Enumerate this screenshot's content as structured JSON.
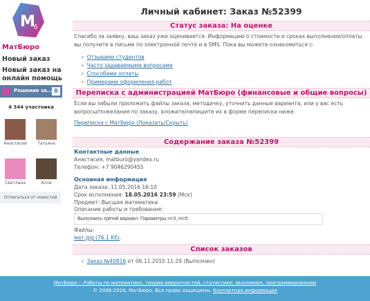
{
  "sidebar": {
    "logo_text": "Мб",
    "brand": "МатБюро",
    "nav": [
      "Новый заказ",
      "Новый заказ на онлайн помощь"
    ],
    "vk": {
      "title": "Решение за...",
      "badge": "B",
      "members": "4 344 участника",
      "people": [
        "Анастасия",
        "Татьяна",
        "Светлана",
        "Алла"
      ],
      "unsubscribe": "Отписаться от новостей"
    }
  },
  "main": {
    "title": "Личный кабинет: Заказ №52399",
    "status": {
      "heading": "Статус заказа: На оценке",
      "text": "Спасибо за заявку, ваш заказ уже оценивается. Информацию о стоимости и сроках выполнения/оплаты вы получите в письме по электронной почте и в SMS. Пока вы можете ознакомиться с:",
      "links": [
        "Отзывами студентов",
        "Часто задаваемыми вопросами",
        "Способами оплаты",
        "Примерами оформления работ"
      ]
    },
    "correspondence": {
      "heading": "Переписка с администрацией МатБюро (финансовые и общие вопросы)",
      "text": "Если вы забыли приложить файлы заказа, методичку, уточнить данные варианта, или у вас есть вопросы/пожелания по заказу, вложите/напишите их в форме переписки ниже.",
      "toggle": "Переписка с МатБюро (Показать/Скрыть)"
    },
    "contents": {
      "heading": "Содержание заказа №52399",
      "contact_heading": "Контактные данные",
      "contact": "Анастасия, matburo@yandex.ru",
      "phone": "Телефон: +7 9046290455",
      "info_heading": "Основная информация",
      "date": "Дата заказа: 11.05.2016 16:10",
      "deadline_label": "Срок исполнения:",
      "deadline": "18.05.2016 23:59",
      "deadline_tz": "(Мск)",
      "subject": "Предмет: Высшая математика",
      "desc_label": "Описание работы и требования:",
      "desc": "Выполнить третий вариант. Параметры n=3, m=5",
      "files_label": "Файлы:",
      "file": "мат.jpg (76.1 Кб)"
    },
    "orders": {
      "heading": "Список заказов",
      "link": "Заказ №40816",
      "rest": "от 06.11.2015 11:29 (Выполнен)"
    }
  },
  "footer": {
    "line1": "МатБюро :: Работы по математике, теории вероятностей, статистике, экономике, программированию",
    "copyright": "© 2006-2016, МатБюро. Все права защищены.",
    "contact": "Контактная информация"
  },
  "colors": {
    "accent": "#b5176c",
    "band": "#fbe9f1",
    "footer": "#4fa3d1",
    "link": "#2a6fa3"
  }
}
